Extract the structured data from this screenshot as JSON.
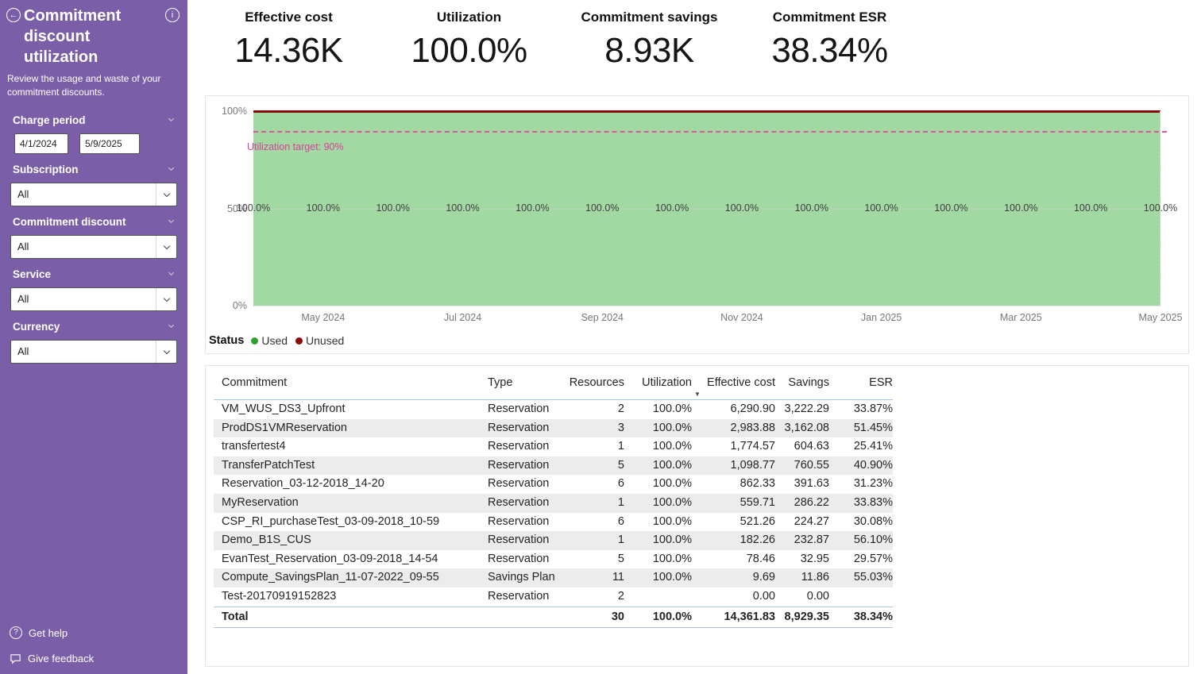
{
  "colors": {
    "sidebar_bg": "#7a5fa8",
    "used": "#2f9e2f",
    "used_fill": "#a2d8a2",
    "unused": "#8a0a0a",
    "target": "#d6429a"
  },
  "sidebar": {
    "title": "Commitment discount utilization",
    "subtitle": "Review the usage and waste of your commitment discounts.",
    "charge_period": {
      "label": "Charge period",
      "start": "4/1/2024",
      "end": "5/9/2025"
    },
    "dropdowns": [
      {
        "label": "Subscription",
        "value": "All"
      },
      {
        "label": "Commitment discount",
        "value": "All"
      },
      {
        "label": "Service",
        "value": "All"
      },
      {
        "label": "Currency",
        "value": "All"
      }
    ],
    "footer_links": [
      {
        "label": "Get help",
        "icon": "help-icon"
      },
      {
        "label": "Give feedback",
        "icon": "feedback-icon"
      }
    ]
  },
  "kpis": [
    {
      "label": "Effective cost",
      "value": "14.36K"
    },
    {
      "label": "Utilization",
      "value": "100.0%"
    },
    {
      "label": "Commitment savings",
      "value": "8.93K"
    },
    {
      "label": "Commitment ESR",
      "value": "38.34%"
    }
  ],
  "chart_data": {
    "type": "area",
    "x": [
      "Apr 2024",
      "May 2024",
      "Jun 2024",
      "Jul 2024",
      "Aug 2024",
      "Sep 2024",
      "Oct 2024",
      "Nov 2024",
      "Dec 2024",
      "Jan 2025",
      "Feb 2025",
      "Mar 2025",
      "Apr 2025",
      "May 2025"
    ],
    "series": [
      {
        "name": "Used",
        "values": [
          100,
          100,
          100,
          100,
          100,
          100,
          100,
          100,
          100,
          100,
          100,
          100,
          100,
          100
        ]
      },
      {
        "name": "Unused",
        "values": [
          0,
          0,
          0,
          0,
          0,
          0,
          0,
          0,
          0,
          0,
          0,
          0,
          0,
          0
        ]
      }
    ],
    "data_labels": [
      "100.0%",
      "100.0%",
      "100.0%",
      "100.0%",
      "100.0%",
      "100.0%",
      "100.0%",
      "100.0%",
      "100.0%",
      "100.0%",
      "100.0%",
      "100.0%",
      "100.0%",
      "100.0%"
    ],
    "ylim": [
      0,
      100
    ],
    "y_ticks": [
      {
        "label": "100%",
        "value": 100
      },
      {
        "label": "50%",
        "value": 50
      },
      {
        "label": "0%",
        "value": 0
      }
    ],
    "x_ticks": [
      "May 2024",
      "Jul 2024",
      "Sep 2024",
      "Nov 2024",
      "Jan 2025",
      "Mar 2025",
      "May 2025"
    ],
    "target": {
      "label": "Utilization target: 90%",
      "value": 90
    },
    "legend": {
      "title": "Status",
      "items": [
        {
          "label": "Used",
          "color": "#2f9e2f"
        },
        {
          "label": "Unused",
          "color": "#8a0a0a"
        }
      ]
    }
  },
  "table": {
    "columns": [
      {
        "label": "Commitment"
      },
      {
        "label": "Type"
      },
      {
        "label": "Resources"
      },
      {
        "label": "Utilization"
      },
      {
        "label": "Effective cost",
        "sort": "desc"
      },
      {
        "label": "Savings"
      },
      {
        "label": "ESR"
      }
    ],
    "rows": [
      [
        "VM_WUS_DS3_Upfront",
        "Reservation",
        "2",
        "100.0%",
        "6,290.90",
        "3,222.29",
        "33.87%"
      ],
      [
        "ProdDS1VMReservation",
        "Reservation",
        "3",
        "100.0%",
        "2,983.88",
        "3,162.08",
        "51.45%"
      ],
      [
        "transfertest4",
        "Reservation",
        "1",
        "100.0%",
        "1,774.57",
        "604.63",
        "25.41%"
      ],
      [
        "TransferPatchTest",
        "Reservation",
        "5",
        "100.0%",
        "1,098.77",
        "760.55",
        "40.90%"
      ],
      [
        "Reservation_03-12-2018_14-20",
        "Reservation",
        "6",
        "100.0%",
        "862.33",
        "391.63",
        "31.23%"
      ],
      [
        "MyReservation",
        "Reservation",
        "1",
        "100.0%",
        "559.71",
        "286.22",
        "33.83%"
      ],
      [
        "CSP_RI_purchaseTest_03-09-2018_10-59",
        "Reservation",
        "6",
        "100.0%",
        "521.26",
        "224.27",
        "30.08%"
      ],
      [
        "Demo_B1S_CUS",
        "Reservation",
        "1",
        "100.0%",
        "182.26",
        "232.87",
        "56.10%"
      ],
      [
        "EvanTest_Reservation_03-09-2018_14-54",
        "Reservation",
        "5",
        "100.0%",
        "78.46",
        "32.95",
        "29.57%"
      ],
      [
        "Compute_SavingsPlan_11-07-2022_09-55",
        "Savings Plan",
        "11",
        "100.0%",
        "9.69",
        "11.86",
        "55.03%"
      ],
      [
        "Test-20170919152823",
        "Reservation",
        "2",
        "",
        "0.00",
        "0.00",
        ""
      ]
    ],
    "total": [
      "Total",
      "",
      "30",
      "100.0%",
      "14,361.83",
      "8,929.35",
      "38.34%"
    ]
  }
}
